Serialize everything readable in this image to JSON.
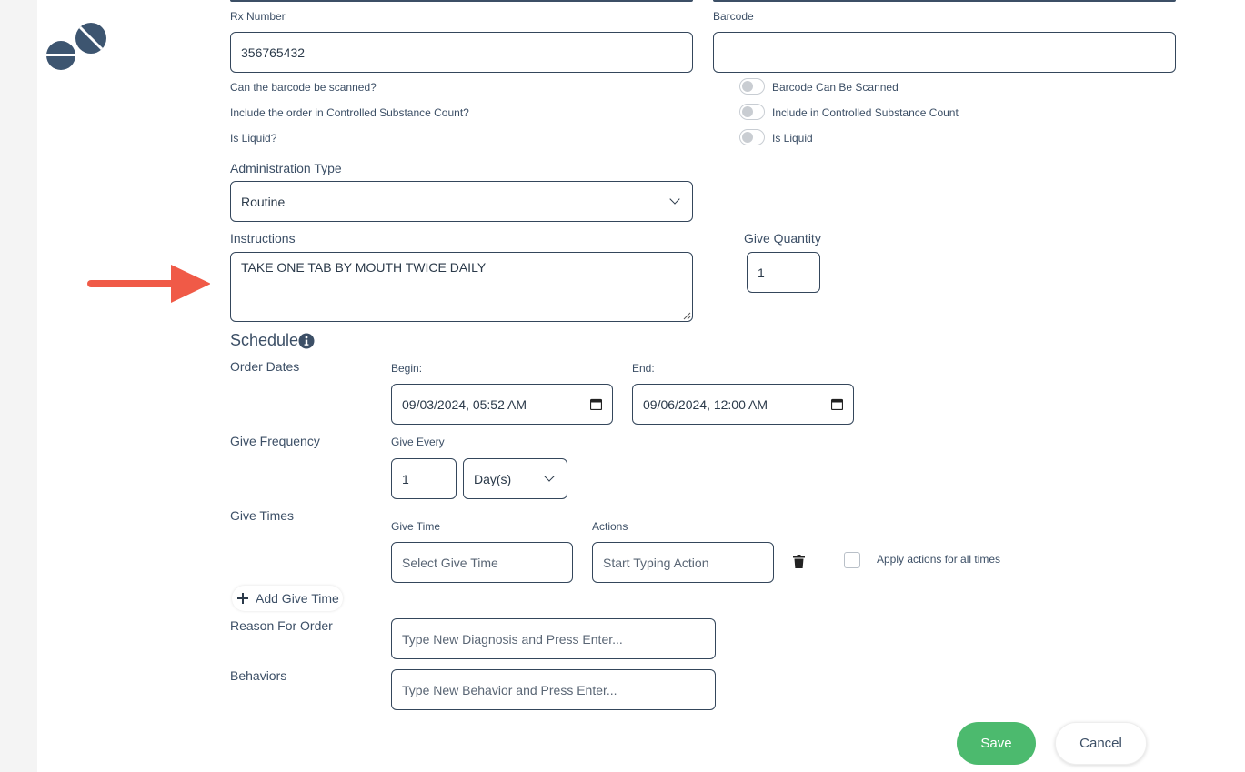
{
  "fields": {
    "rx_number_label": "Rx Number",
    "rx_number_value": "356765432",
    "barcode_label": "Barcode",
    "barcode_value": ""
  },
  "questions": {
    "barcode_scanned": "Can the barcode be scanned?",
    "controlled_count": "Include the order in Controlled Substance Count?",
    "is_liquid": "Is Liquid?"
  },
  "toggles": {
    "barcode_scanned": "Barcode Can Be Scanned",
    "controlled_count": "Include in Controlled Substance Count",
    "is_liquid": "Is Liquid",
    "barcode_scanned_on": false,
    "controlled_count_on": false,
    "is_liquid_on": false
  },
  "administration": {
    "label": "Administration Type",
    "value": "Routine"
  },
  "instructions": {
    "label": "Instructions",
    "value": "TAKE ONE TAB BY MOUTH TWICE DAILY"
  },
  "give_quantity": {
    "label": "Give Quantity",
    "value": "1"
  },
  "schedule": {
    "title": "Schedule",
    "order_dates_label": "Order Dates",
    "begin_label": "Begin:",
    "begin_value": "09/03/2024, 05:52 AM",
    "end_label": "End:",
    "end_value": "09/06/2024, 12:00 AM",
    "give_frequency_label": "Give Frequency",
    "give_every_label": "Give Every",
    "give_every_value": "1",
    "give_every_unit": "Day(s)",
    "give_times_label": "Give Times",
    "give_time_col_label": "Give Time",
    "give_time_placeholder": "Select Give Time",
    "actions_col_label": "Actions",
    "actions_placeholder": "Start Typing Action",
    "apply_all_label": "Apply actions for all times",
    "add_give_time": "Add Give Time"
  },
  "reason": {
    "label": "Reason For Order",
    "placeholder": "Type New Diagnosis and Press Enter..."
  },
  "behaviors": {
    "label": "Behaviors",
    "placeholder": "Type New Behavior and Press Enter..."
  },
  "buttons": {
    "save": "Save",
    "cancel": "Cancel"
  },
  "colors": {
    "accent": "#3c4f66",
    "save": "#4cba6e",
    "arrow": "#f05a47"
  },
  "icons": {
    "logo": "pills-logo-icon",
    "info": "info-icon",
    "trash": "trash-icon",
    "plus": "plus-icon",
    "calendar": "calendar-icon",
    "arrow": "arrow-right-icon"
  }
}
